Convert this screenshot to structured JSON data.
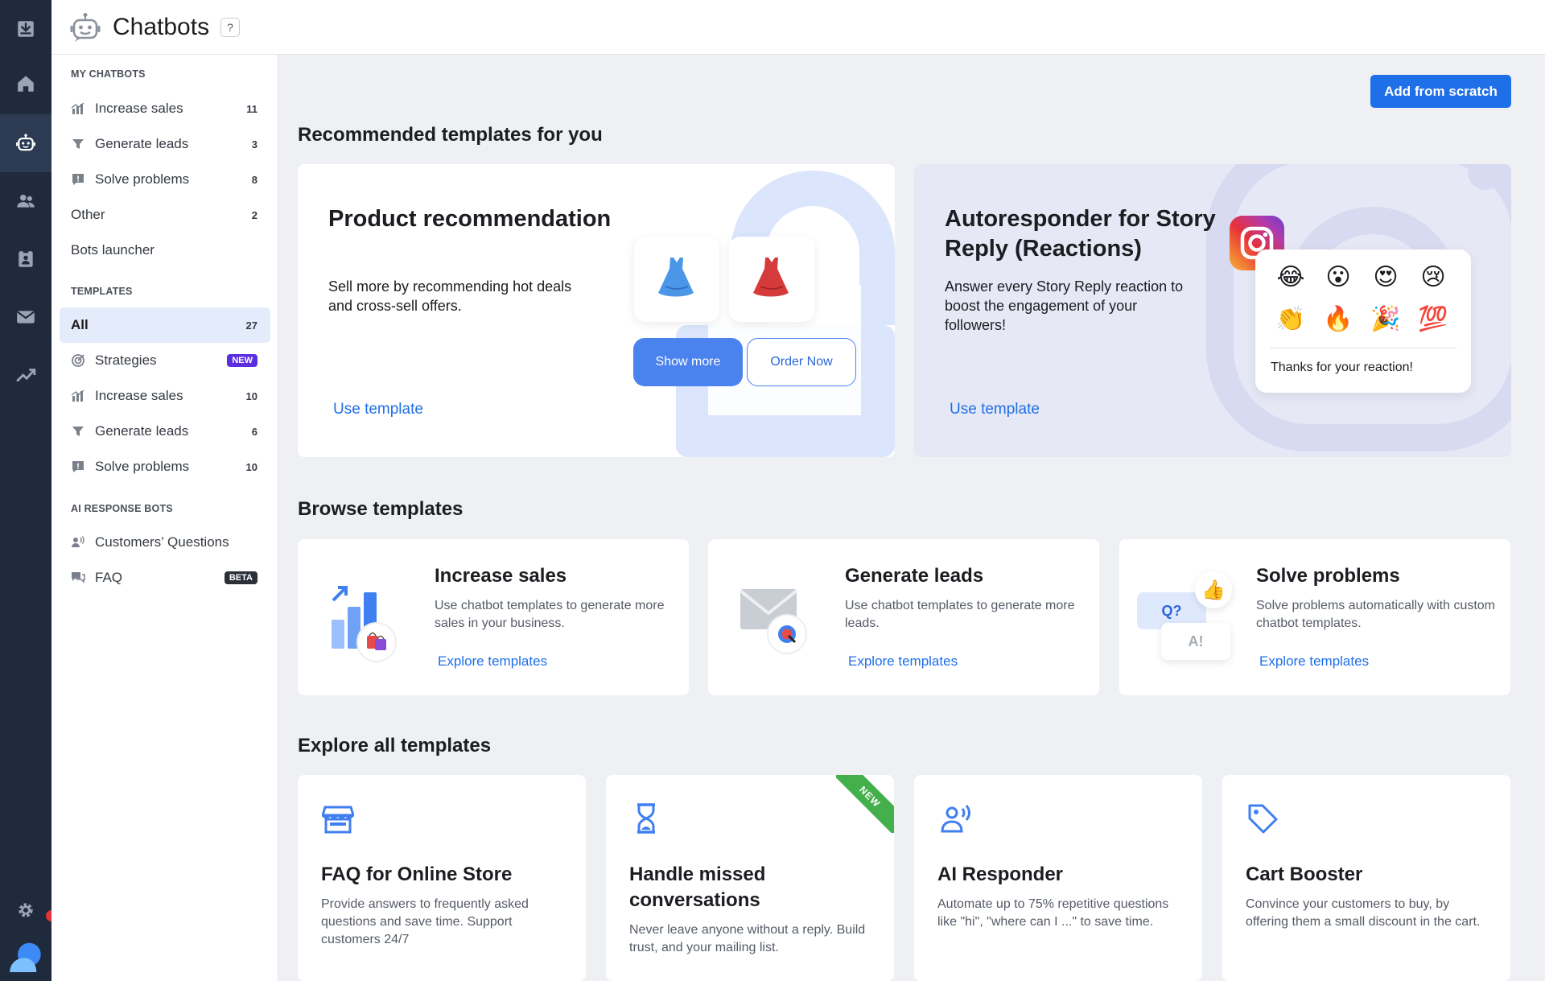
{
  "app": {
    "title": "Chatbots",
    "help_label": "?"
  },
  "colors": {
    "accent": "#1f6fe8",
    "rail": "#1f2a3d",
    "new_badge": "#5b2ee0",
    "ribbon": "#43b04b"
  },
  "rail": [
    {
      "icon": "inbox-icon"
    },
    {
      "icon": "home-icon"
    },
    {
      "icon": "chatbot-icon",
      "active": true
    },
    {
      "icon": "contacts-icon"
    },
    {
      "icon": "automation-icon"
    },
    {
      "icon": "campaigns-icon"
    },
    {
      "icon": "analytics-icon"
    },
    {
      "icon": "settings-icon"
    },
    {
      "icon": "profile-icon"
    }
  ],
  "sidebar": {
    "my_chatbots_title": "MY CHATBOTS",
    "my_chatbots": [
      {
        "label": "Increase sales",
        "count": "11",
        "icon": "chart-icon"
      },
      {
        "label": "Generate leads",
        "count": "3",
        "icon": "funnel-icon"
      },
      {
        "label": "Solve problems",
        "count": "8",
        "icon": "help-chat-icon"
      },
      {
        "label": "Other",
        "count": "2"
      },
      {
        "label": "Bots launcher"
      }
    ],
    "templates_title": "TEMPLATES",
    "templates": [
      {
        "label": "All",
        "count": "27"
      },
      {
        "label": "Strategies",
        "badge": "NEW",
        "icon": "target-icon"
      },
      {
        "label": "Increase sales",
        "count": "10",
        "icon": "chart-icon"
      },
      {
        "label": "Generate leads",
        "count": "6",
        "icon": "funnel-icon"
      },
      {
        "label": "Solve problems",
        "count": "10",
        "icon": "help-chat-icon"
      }
    ],
    "ai_title": "AI RESPONSE BOTS",
    "ai": [
      {
        "label": "Customers’ Questions",
        "icon": "people-voice-icon"
      },
      {
        "label": "FAQ",
        "badge": "BETA",
        "icon": "faq-icon"
      }
    ]
  },
  "main": {
    "add_button": "Add from scratch",
    "recommended_title": "Recommended templates for you",
    "recommended": [
      {
        "title": "Product recommendation",
        "description": "Sell more by recommending hot deals and cross-sell offers.",
        "link": "Use template",
        "show_more": "Show more",
        "order_now": "Order Now"
      },
      {
        "title": "Autoresponder for Story Reply (Reactions)",
        "description": "Answer every Story Reply reaction to boost the engagement of your followers!",
        "link": "Use template",
        "emojis": [
          "😂",
          "😮",
          "😍",
          "😢",
          "👏",
          "🔥",
          "🎉",
          "💯"
        ],
        "thanks": "Thanks for your reaction!"
      }
    ],
    "browse_title": "Browse templates",
    "browse": [
      {
        "title": "Increase sales",
        "description": "Use chatbot templates to generate more sales in your business.",
        "link": "Explore templates"
      },
      {
        "title": "Generate leads",
        "description": "Use chatbot templates to generate more leads.",
        "link": "Explore templates"
      },
      {
        "title": "Solve problems",
        "description": "Solve problems automatically with custom chatbot templates.",
        "link": "Explore templates",
        "q_label": "Q?",
        "a_label": "A!"
      }
    ],
    "explore_title": "Explore all templates",
    "explore": [
      {
        "title": "FAQ for Online Store",
        "description": "Provide answers to frequently asked questions and save time. Support customers 24/7",
        "icon": "store-icon"
      },
      {
        "title": "Handle missed conversations",
        "description": "Never leave anyone without a reply. Build trust, and your mailing list.",
        "icon": "hourglass-icon",
        "ribbon": "NEW"
      },
      {
        "title": "AI Responder",
        "description": "Automate up to 75% repetitive questions like \"hi\", \"where can I ...\" to save time.",
        "icon": "ai-voice-icon"
      },
      {
        "title": "Cart Booster",
        "description": "Convince your customers to buy, by offering them a small discount in the cart.",
        "icon": "tag-icon"
      }
    ]
  }
}
